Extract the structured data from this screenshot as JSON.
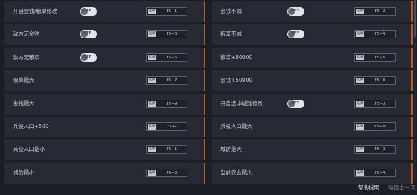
{
  "left_options": [
    {
      "label": "开启金钱/粮草修改",
      "toggle": "OFF",
      "mod": "选择",
      "key": "F5+1"
    },
    {
      "label": "敌方无金钱",
      "toggle": "OFF",
      "mod": "选择",
      "key": "F5+3"
    },
    {
      "label": "敌方无粮草",
      "toggle": "OFF",
      "mod": "选择",
      "key": "F5+5"
    },
    {
      "label": "粮草最大",
      "toggle": null,
      "mod": "选择",
      "key": "F5+7"
    },
    {
      "label": "金钱最大",
      "toggle": null,
      "mod": "选择",
      "key": "F5+9"
    },
    {
      "label": "兵役人口+500",
      "toggle": null,
      "mod": "选择",
      "key": "F5+-"
    },
    {
      "label": "兵役人口最小",
      "toggle": null,
      "mod": "选择",
      "key": "F6+1"
    },
    {
      "label": "城防最小",
      "toggle": null,
      "mod": "选择",
      "key": "F6+3"
    }
  ],
  "right_options": [
    {
      "label": "金钱不减",
      "toggle": "OFF",
      "mod": "选择",
      "key": "F5+2"
    },
    {
      "label": "粮草不减",
      "toggle": "OFF",
      "mod": "选择",
      "key": "F5+4"
    },
    {
      "label": "粮草+50000",
      "toggle": null,
      "mod": "选择",
      "key": "F5+6"
    },
    {
      "label": "金钱+50000",
      "toggle": null,
      "mod": "选择",
      "key": "F5+8"
    },
    {
      "label": "开启选中城池修改",
      "toggle": "OFF",
      "mod": "选择",
      "key": "F5+0"
    },
    {
      "label": "兵役人口最大",
      "toggle": null,
      "mod": "选择",
      "key": "F5+="
    },
    {
      "label": "城防最大",
      "toggle": null,
      "mod": "选择",
      "key": "F6+2"
    },
    {
      "label": "当前农业最大",
      "toggle": null,
      "mod": "选择",
      "key": "F6+4"
    }
  ],
  "footer": {
    "help": "帮助说明",
    "back": "返回上一页"
  }
}
